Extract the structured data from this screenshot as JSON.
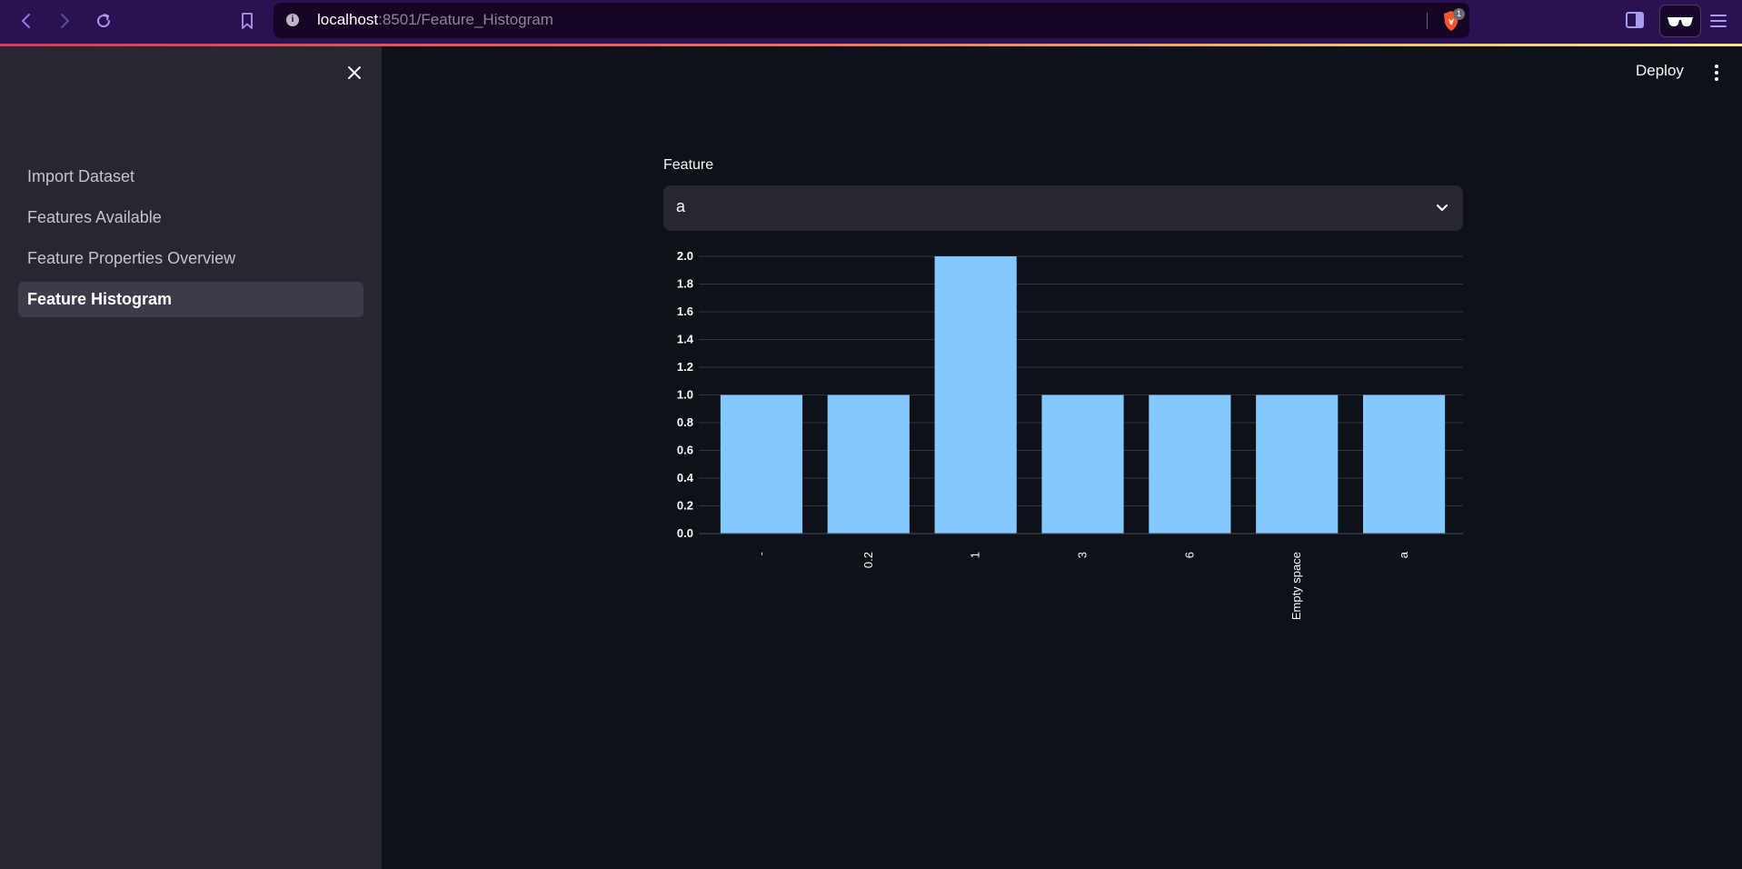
{
  "browser": {
    "url_host": "localhost",
    "url_rest": ":8501/Feature_Histogram",
    "shield_count": "1"
  },
  "sidebar": {
    "items": [
      {
        "label": "Import Dataset",
        "active": false
      },
      {
        "label": "Features Available",
        "active": false
      },
      {
        "label": "Feature Properties Overview",
        "active": false
      },
      {
        "label": "Feature Histogram",
        "active": true
      }
    ]
  },
  "header": {
    "deploy_label": "Deploy"
  },
  "main": {
    "select_label": "Feature",
    "select_value": "a"
  },
  "colors": {
    "bar": "#83c9ff",
    "background": "#0e1117",
    "sidebar": "#262730",
    "grid": "#31333f"
  },
  "chart_data": {
    "type": "bar",
    "categories": [
      "-",
      "0.2",
      "1",
      "3",
      "6",
      "Empty space",
      "a"
    ],
    "values": [
      1,
      1,
      2,
      1,
      1,
      1,
      1
    ],
    "title": "",
    "xlabel": "",
    "ylabel": "",
    "ylim": [
      0,
      2
    ],
    "yticks": [
      "0.0",
      "0.2",
      "0.4",
      "0.6",
      "0.8",
      "1.0",
      "1.2",
      "1.4",
      "1.6",
      "1.8",
      "2.0"
    ],
    "grid": true
  }
}
